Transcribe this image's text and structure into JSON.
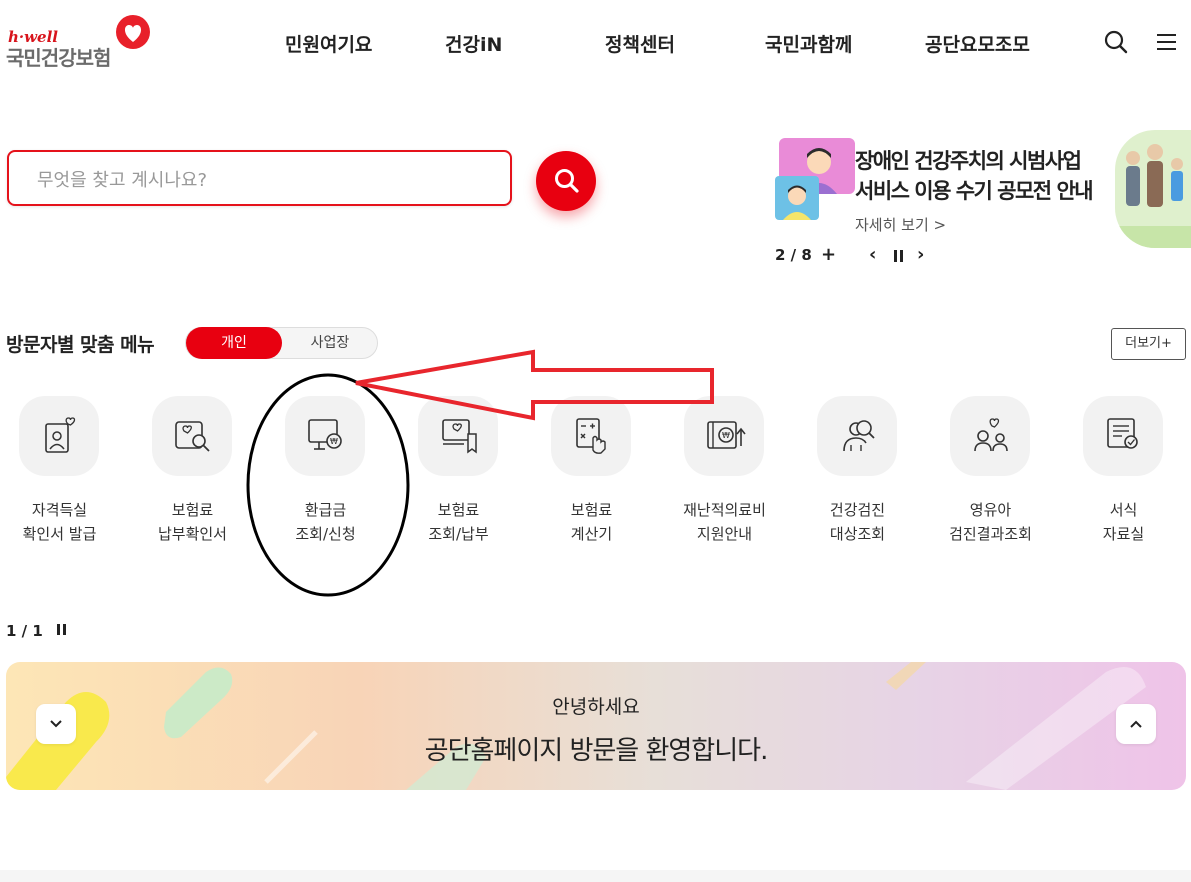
{
  "header": {
    "logo": {
      "tagline": "h·well",
      "name": "국민건강보험"
    },
    "nav": [
      "민원여기요",
      "건강iN",
      "정책센터",
      "국민과함께",
      "공단요모조모"
    ],
    "icons": [
      "search-icon",
      "menu-icon"
    ]
  },
  "search": {
    "placeholder": "무엇을 찾고 계시나요?",
    "value": ""
  },
  "banner": {
    "title_line1": "장애인 건강주치의 시범사업",
    "title_line2": "서비스 이용 수기 공모전 안내",
    "more": "자세히 보기 >",
    "pager": "2 / 8",
    "plus": "+",
    "prev": "‹",
    "next": "›"
  },
  "visitor_menu": {
    "title": "방문자별 맞춤 메뉴",
    "toggle_on": "개인",
    "toggle_off": "사업장",
    "more": "더보기+",
    "pager": "1 / 1",
    "items": [
      {
        "line1": "자격득실",
        "line2": "확인서 발급",
        "icon": "id-card-heart-icon"
      },
      {
        "line1": "보험료",
        "line2": "납부확인서",
        "icon": "document-search-icon"
      },
      {
        "line1": "환급금",
        "line2": "조회/신청",
        "icon": "monitor-won-icon"
      },
      {
        "line1": "보험료",
        "line2": "조회/납부",
        "icon": "bill-heart-icon"
      },
      {
        "line1": "보험료",
        "line2": "계산기",
        "icon": "calculator-icon"
      },
      {
        "line1": "재난적의료비",
        "line2": "지원안내",
        "icon": "won-support-icon"
      },
      {
        "line1": "건강검진",
        "line2": "대상조회",
        "icon": "person-search-icon"
      },
      {
        "line1": "영유아",
        "line2": "검진결과조회",
        "icon": "family-icon"
      },
      {
        "line1": "서식",
        "line2": "자료실",
        "icon": "form-search-icon"
      }
    ]
  },
  "welcome": {
    "sub": "안녕하세요",
    "main": "공단홈페이지 방문을 환영합니다.",
    "down_icon": "chevron-down-icon",
    "up_icon": "chevron-up-icon"
  },
  "annotation": {
    "color": "#e8262d"
  }
}
